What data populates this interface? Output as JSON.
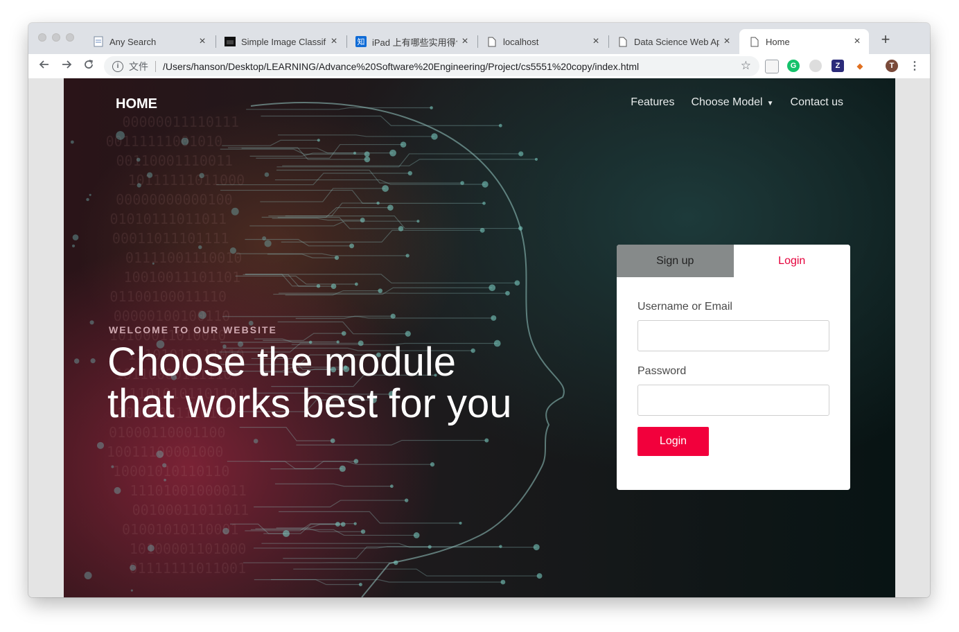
{
  "browser": {
    "tabs": [
      {
        "title": "Any Search",
        "favicon": "document-search-icon"
      },
      {
        "title": "Simple Image Classifi",
        "favicon": "dark-image-icon"
      },
      {
        "title": "iPad 上有哪些实用得令",
        "favicon": "zhihu-icon"
      },
      {
        "title": "localhost",
        "favicon": "page-icon"
      },
      {
        "title": "Data Science Web Ap",
        "favicon": "page-icon"
      },
      {
        "title": "Home",
        "favicon": "page-icon",
        "active": true
      }
    ],
    "address": {
      "scheme_label": "文件",
      "url": "/Users/hanson/Desktop/LEARNING/Advance%20Software%20Engineering/Project/cs5551%20copy/index.html"
    },
    "profile_initial": "T"
  },
  "site": {
    "brand": "HOME",
    "nav": {
      "features": "Features",
      "choose_model": "Choose Model",
      "contact": "Contact us"
    },
    "hero": {
      "kicker": "WELCOME TO OUR WEBSITE",
      "headline_line1": "Choose the module",
      "headline_line2": "that works best for you"
    },
    "auth": {
      "tab_signup": "Sign up",
      "tab_login": "Login",
      "username_label": "Username or Email",
      "password_label": "Password",
      "submit_label": "Login"
    }
  },
  "colors": {
    "accent": "#f2003c",
    "login_tab_text": "#e5003b",
    "signup_tab_bg": "#868a8a"
  }
}
